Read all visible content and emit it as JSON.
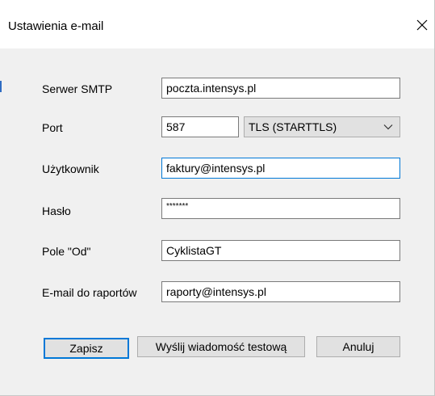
{
  "window": {
    "title": "Ustawienia e-mail"
  },
  "form": {
    "smtp_label": "Serwer SMTP",
    "smtp_value": "poczta.intensys.pl",
    "port_label": "Port",
    "port_value": "587",
    "security_value": "TLS (STARTTLS)",
    "user_label": "Użytkownik",
    "user_value": "faktury@intensys.pl",
    "password_label": "Hasło",
    "password_value": "*******",
    "from_label": "Pole \"Od\"",
    "from_value": "CyklistaGT",
    "report_email_label": "E-mail do raportów",
    "report_email_value": "raporty@intensys.pl"
  },
  "buttons": {
    "save": "Zapisz",
    "send_test": "Wyślij wiadomość testową",
    "cancel": "Anuluj"
  },
  "colors": {
    "accent": "#0078d7",
    "button_bg": "#e1e1e1",
    "window_bg": "#f0f0f0"
  },
  "icons": {
    "close": "close-icon",
    "dropdown": "chevron-down-icon"
  }
}
